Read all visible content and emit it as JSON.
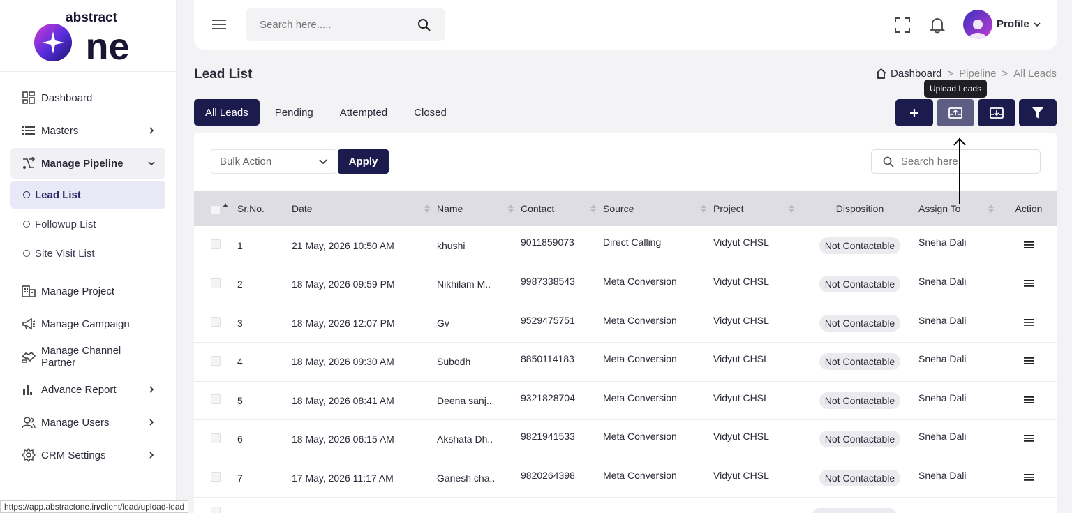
{
  "logo": {
    "top_text": "abstract",
    "main_text": "one"
  },
  "sidebar": {
    "items": [
      {
        "label": "Dashboard",
        "icon": "grid-icon"
      },
      {
        "label": "Masters",
        "icon": "list-icon"
      },
      {
        "label": "Manage Pipeline",
        "icon": "pipeline-icon"
      }
    ],
    "sub_items": [
      {
        "label": "Lead List"
      },
      {
        "label": "Followup List"
      },
      {
        "label": "Site Visit List"
      }
    ],
    "items2": [
      {
        "label": "Manage Project",
        "icon": "building-icon"
      },
      {
        "label": "Manage Campaign",
        "icon": "megaphone-icon"
      },
      {
        "label": "Manage Channel Partner",
        "icon": "handshake-icon"
      },
      {
        "label": "Advance Report",
        "icon": "bar-chart-icon"
      },
      {
        "label": "Manage Users",
        "icon": "users-icon"
      },
      {
        "label": "CRM Settings",
        "icon": "gear-icon"
      }
    ]
  },
  "topbar": {
    "search_placeholder": "Search here.....",
    "profile_label": "Profile"
  },
  "page": {
    "title": "Lead List"
  },
  "breadcrumb": {
    "home": "Dashboard",
    "sep": ">",
    "second": "Pipeline",
    "third": "All Leads"
  },
  "tabs": [
    "All Leads",
    "Pending",
    "Attempted",
    "Closed"
  ],
  "tooltip": "Upload Leads",
  "toolbar": {
    "bulk_action": "Bulk Action",
    "apply": "Apply",
    "search_placeholder": "Search here"
  },
  "table": {
    "headers": [
      "Sr.No.",
      "Date",
      "Name",
      "Contact",
      "Source",
      "Project",
      "Disposition",
      "Assign To",
      "Action"
    ],
    "rows": [
      {
        "sr": "1",
        "date": "21 May, 2026 10:50 AM",
        "name": "khushi",
        "contact": "9011859073",
        "source": "Direct Calling",
        "project": "Vidyut CHSL",
        "disposition": "Not Contactable",
        "assign": "Sneha Dali"
      },
      {
        "sr": "2",
        "date": "18 May, 2026 09:59 PM",
        "name": "Nikhilam M..",
        "contact": "9987338543",
        "source": "Meta Conversion",
        "project": "Vidyut CHSL",
        "disposition": "Not Contactable",
        "assign": "Sneha Dali"
      },
      {
        "sr": "3",
        "date": "18 May, 2026 12:07 PM",
        "name": "Gv",
        "contact": "9529475751",
        "source": "Meta Conversion",
        "project": "Vidyut CHSL",
        "disposition": "Not Contactable",
        "assign": "Sneha Dali"
      },
      {
        "sr": "4",
        "date": "18 May, 2026 09:30 AM",
        "name": "Subodh",
        "contact": "8850114183",
        "source": "Meta Conversion",
        "project": "Vidyut CHSL",
        "disposition": "Not Contactable",
        "assign": "Sneha Dali"
      },
      {
        "sr": "5",
        "date": "18 May, 2026 08:41 AM",
        "name": "Deena sanj..",
        "contact": "9321828704",
        "source": "Meta Conversion",
        "project": "Vidyut CHSL",
        "disposition": "Not Contactable",
        "assign": "Sneha Dali"
      },
      {
        "sr": "6",
        "date": "18 May, 2026 06:15 AM",
        "name": "Akshata Dh..",
        "contact": "9821941533",
        "source": "Meta Conversion",
        "project": "Vidyut CHSL",
        "disposition": "Not Contactable",
        "assign": "Sneha Dali"
      },
      {
        "sr": "7",
        "date": "17 May, 2026 11:17 AM",
        "name": "Ganesh cha..",
        "contact": "9820264398",
        "source": "Meta Conversion",
        "project": "Vidyut CHSL",
        "disposition": "Not Contactable",
        "assign": "Sneha Dali"
      }
    ]
  },
  "status_url": "https://app.abstractone.in/client/lead/upload-lead",
  "colors": {
    "primary": "#1c1b4e",
    "active_sub": "#e8e8f6",
    "header_bg": "#dedde3"
  }
}
